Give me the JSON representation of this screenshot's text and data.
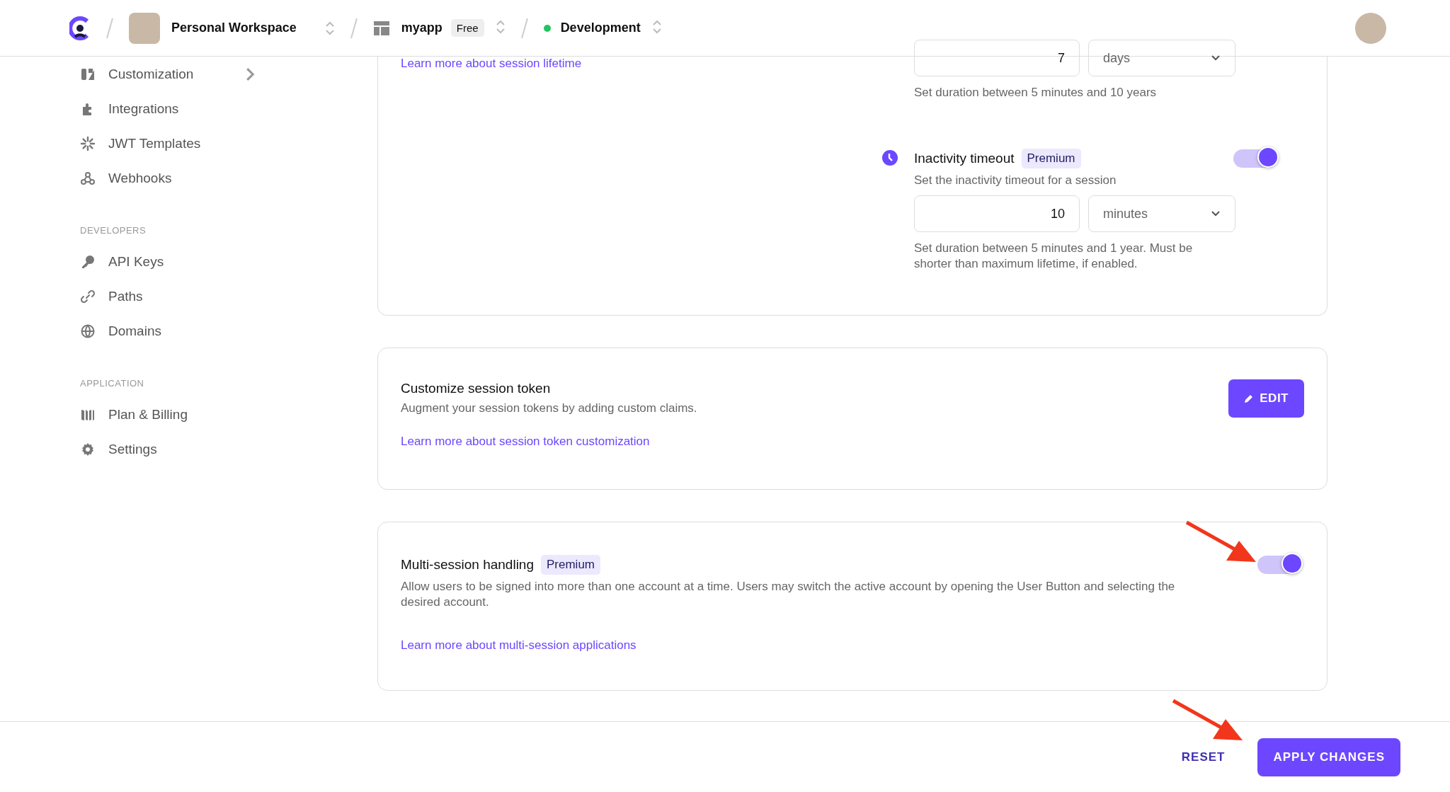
{
  "topbar": {
    "workspace": "Personal Workspace",
    "app": {
      "name": "myapp",
      "plan": "Free"
    },
    "environment": {
      "name": "Development",
      "color": "#22c55e"
    }
  },
  "sidebar": {
    "groups": [
      {
        "items": [
          {
            "label": "Customization",
            "has_submenu": true
          },
          {
            "label": "Integrations",
            "has_submenu": false
          },
          {
            "label": "JWT Templates",
            "has_submenu": false
          },
          {
            "label": "Webhooks",
            "has_submenu": false
          }
        ]
      },
      {
        "heading": "DEVELOPERS",
        "items": [
          {
            "label": "API Keys",
            "has_submenu": false
          },
          {
            "label": "Paths",
            "has_submenu": false
          },
          {
            "label": "Domains",
            "has_submenu": false
          }
        ]
      },
      {
        "heading": "APPLICATION",
        "items": [
          {
            "label": "Plan & Billing",
            "has_submenu": false
          },
          {
            "label": "Settings",
            "has_submenu": false
          }
        ]
      }
    ]
  },
  "session_lifetime": {
    "learn_more": "Learn more about session lifetime",
    "max_lifetime": {
      "value": "7",
      "unit": "days",
      "help": "Set duration between 5 minutes and 10 years"
    },
    "inactivity_timeout": {
      "title": "Inactivity timeout",
      "badge": "Premium",
      "description": "Set the inactivity timeout for a session",
      "on": true,
      "value": "10",
      "unit": "minutes",
      "help": "Set duration between 5 minutes and 1 year. Must be shorter than maximum lifetime, if enabled."
    }
  },
  "session_token": {
    "title": "Customize session token",
    "description": "Augment your session tokens by adding custom claims.",
    "link": "Learn more about session token customization",
    "edit_button": "EDIT"
  },
  "multi_session": {
    "title": "Multi-session handling",
    "badge": "Premium",
    "description": "Allow users to be signed into more than one account at a time. Users may switch the active account by opening the User Button and selecting the desired account.",
    "link": "Learn more about multi-session applications",
    "on": true
  },
  "footer": {
    "reset": "RESET",
    "apply": "APPLY CHANGES"
  }
}
